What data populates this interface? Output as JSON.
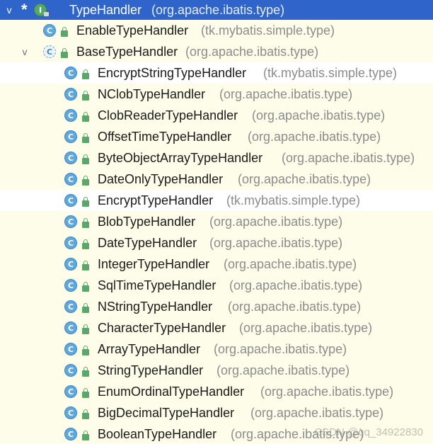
{
  "root": {
    "toggle": "v",
    "star": "*",
    "icon_letter": "I",
    "name": "TypeHandler",
    "package": "(org.apache.ibatis.type)"
  },
  "level1": [
    {
      "icon_letter": "C",
      "name": "EnableTypeHandler",
      "package": "(tk.mybatis.simple.type)"
    },
    {
      "toggle": "v",
      "icon_letter": "C",
      "name": "BaseTypeHandler",
      "package": "(org.apache.ibatis.type)"
    }
  ],
  "children": [
    {
      "icon_letter": "C",
      "name": "EncryptStringTypeHandler",
      "package": "(tk.mybatis.simple.type)"
    },
    {
      "icon_letter": "C",
      "name": "NClobTypeHandler",
      "package": "(org.apache.ibatis.type)"
    },
    {
      "icon_letter": "C",
      "name": "ClobReaderTypeHandler",
      "package": "(org.apache.ibatis.type)"
    },
    {
      "icon_letter": "C",
      "name": "OffsetTimeTypeHandler",
      "package": "(org.apache.ibatis.type)"
    },
    {
      "icon_letter": "C",
      "name": "ByteObjectArrayTypeHandler",
      "package": "(org.apache.ibatis.type)"
    },
    {
      "icon_letter": "C",
      "name": "DateOnlyTypeHandler",
      "package": "(org.apache.ibatis.type)"
    },
    {
      "icon_letter": "C",
      "name": "EncryptTypeHandler",
      "package": "(tk.mybatis.simple.type)"
    },
    {
      "icon_letter": "C",
      "name": "BlobTypeHandler",
      "package": "(org.apache.ibatis.type)"
    },
    {
      "icon_letter": "C",
      "name": "DateTypeHandler",
      "package": "(org.apache.ibatis.type)"
    },
    {
      "icon_letter": "C",
      "name": "IntegerTypeHandler",
      "package": "(org.apache.ibatis.type)"
    },
    {
      "icon_letter": "C",
      "name": "SqlTimeTypeHandler",
      "package": "(org.apache.ibatis.type)"
    },
    {
      "icon_letter": "C",
      "name": "NStringTypeHandler",
      "package": "(org.apache.ibatis.type)"
    },
    {
      "icon_letter": "C",
      "name": "CharacterTypeHandler",
      "package": "(org.apache.ibatis.type)"
    },
    {
      "icon_letter": "C",
      "name": "ArrayTypeHandler",
      "package": "(org.apache.ibatis.type)"
    },
    {
      "icon_letter": "C",
      "name": "StringTypeHandler",
      "package": "(org.apache.ibatis.type)"
    },
    {
      "icon_letter": "C",
      "name": "EnumOrdinalTypeHandler",
      "package": "(org.apache.ibatis.type)"
    },
    {
      "icon_letter": "C",
      "name": "BigDecimalTypeHandler",
      "package": "(org.apache.ibatis.type)"
    },
    {
      "icon_letter": "C",
      "name": "BooleanTypeHandler",
      "package": "(org.apache.ibatis.type)"
    }
  ],
  "watermark": "CSDN @qq_34922830",
  "colors": {
    "selection": "#2f65ca",
    "library_row_bg": "#fdfde9",
    "project_row_bg": "#ffffff",
    "class_icon": "#5fa8dd",
    "interface_icon": "#59a869",
    "package_text": "#8c8c8c"
  }
}
